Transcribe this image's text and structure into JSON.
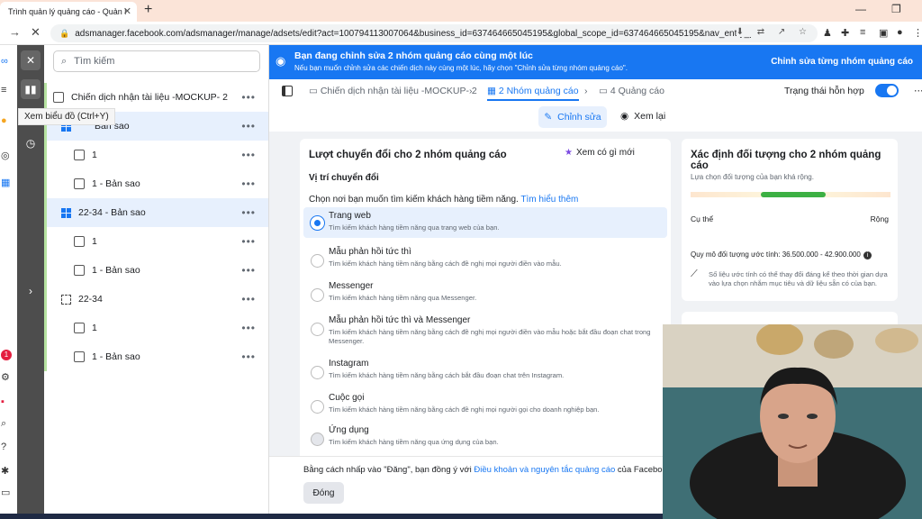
{
  "browser": {
    "tab_title": "Trình quản lý quảng cáo - Quản l",
    "url": "adsmanager.facebook.com/adsmanager/manage/adsets/edit?act=100794113007064&business_id=637464665045195&global_scope_id=637464665045195&nav_entry_p..."
  },
  "sidebar": {
    "search_placeholder": "Tìm kiếm",
    "tooltip": "Xem biểu đồ (Ctrl+Y)",
    "notification_badge": "1",
    "rows": [
      {
        "label": "Chiến dịch nhận tài liệu -MOCKUP- 2"
      },
      {
        "label": "Bản sao"
      },
      {
        "label": "1"
      },
      {
        "label": "1 - Bản sao"
      },
      {
        "label": "22-34 - Bản sao"
      },
      {
        "label": "1"
      },
      {
        "label": "1 - Bản sao"
      },
      {
        "label": "22-34"
      },
      {
        "label": "1"
      },
      {
        "label": "1 - Bản sao"
      }
    ]
  },
  "banner": {
    "title": "Bạn đang chỉnh sửa 2 nhóm quảng cáo cùng một lúc",
    "subtitle": "Nếu bạn muốn chỉnh sửa các chiến dịch này cùng một lúc, hãy chọn \"Chỉnh sửa từng nhóm quảng cáo\".",
    "action": "Chỉnh sửa từng nhóm quảng cáo"
  },
  "breadcrumb": {
    "campaign": "Chiến dịch nhận tài liệu -MOCKUP- 2",
    "adsets": "2 Nhóm quảng cáo",
    "ads": "4 Quảng cáo",
    "mixed_state": "Trạng thái hỗn hợp"
  },
  "modes": {
    "edit": "Chỉnh sửa",
    "review": "Xem lại"
  },
  "conversion_card": {
    "title": "Lượt chuyển đổi cho 2 nhóm quảng cáo",
    "whats_new": "Xem có gì mới",
    "section": "Vị trí chuyển đổi",
    "question": "Chọn nơi bạn muốn tìm kiếm khách hàng tiềm năng.",
    "learn_more": "Tìm hiểu thêm",
    "options": [
      {
        "title": "Trang web",
        "desc": "Tìm kiếm khách hàng tiềm năng qua trang web của bạn."
      },
      {
        "title": "Mẫu phản hồi tức thì",
        "desc": "Tìm kiếm khách hàng tiềm năng bằng cách đề nghị mọi người điền vào mẫu."
      },
      {
        "title": "Messenger",
        "desc": "Tìm kiếm khách hàng tiềm năng qua Messenger."
      },
      {
        "title": "Mẫu phản hồi tức thì và Messenger",
        "desc": "Tìm kiếm khách hàng tiềm năng bằng cách đề nghị mọi người điền vào mẫu hoặc bắt đầu đoạn chat trong Messenger."
      },
      {
        "title": "Instagram",
        "desc": "Tìm kiếm khách hàng tiềm năng bằng cách bắt đầu đoạn chat trên Instagram."
      },
      {
        "title": "Cuộc gọi",
        "desc": "Tìm kiếm khách hàng tiềm năng bằng cách đề nghị mọi người gọi cho doanh nghiệp bạn."
      },
      {
        "title": "Ứng dụng",
        "desc": "Tìm kiếm khách hàng tiềm năng qua ứng dụng của bạn."
      }
    ]
  },
  "audience_card": {
    "title": "Xác định đối tượng cho 2 nhóm quảng cáo",
    "breadth": "Lựa chọn đối tượng của bạn khá rộng.",
    "specific": "Cụ thể",
    "broad": "Rộng",
    "size_label": "Quy mô đối tượng ước tính: 36.500.000 - 42.900.000",
    "estimate_note": "Số liệu ước tính có thể thay đổi đáng kể theo thời gian dựa vào lựa chọn nhắm mục tiêu và dữ liệu sẵn có của bạn."
  },
  "footer": {
    "text": "Bằng cách nhấp vào \"Đăng\", bạn đồng ý với",
    "link": "Điều khoản và nguyên tắc quảng cáo",
    "tail": "của Facebo",
    "done": "Đóng"
  }
}
